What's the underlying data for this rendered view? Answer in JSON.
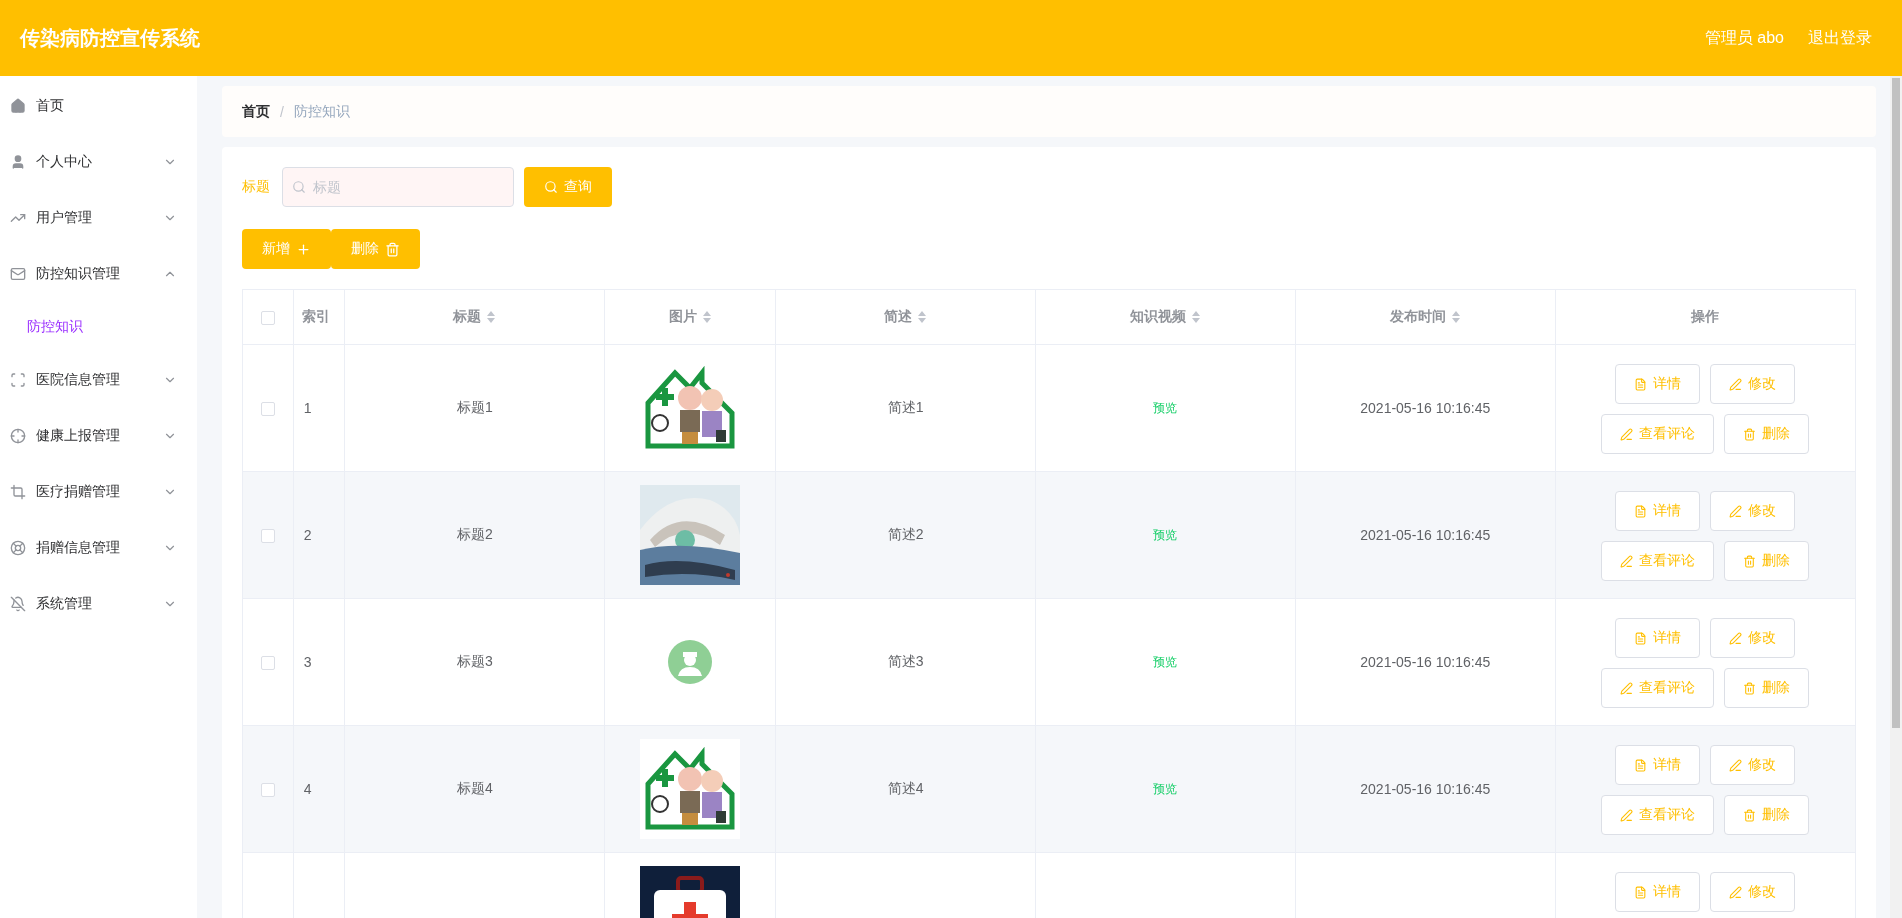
{
  "header": {
    "title": "传染病防控宣传系统",
    "user": "管理员 abo",
    "logout": "退出登录"
  },
  "sidebar": {
    "items": [
      {
        "kind": "link",
        "label": "首页"
      },
      {
        "kind": "menu",
        "label": "个人中心",
        "expanded": false
      },
      {
        "kind": "menu",
        "label": "用户管理",
        "expanded": false
      },
      {
        "kind": "menu",
        "label": "防控知识管理",
        "expanded": true,
        "children": [
          {
            "label": "防控知识",
            "selected": true
          }
        ]
      },
      {
        "kind": "menu",
        "label": "医院信息管理",
        "expanded": false
      },
      {
        "kind": "menu",
        "label": "健康上报管理",
        "expanded": false
      },
      {
        "kind": "menu",
        "label": "医疗捐赠管理",
        "expanded": false
      },
      {
        "kind": "menu",
        "label": "捐赠信息管理",
        "expanded": false
      },
      {
        "kind": "menu",
        "label": "系统管理",
        "expanded": false
      }
    ]
  },
  "breadcrumb": {
    "items": [
      "首页",
      "防控知识"
    ],
    "separator": "/"
  },
  "search": {
    "label": "标题",
    "placeholder": "标题",
    "button": "查询"
  },
  "actions": [
    {
      "label": "新增"
    },
    {
      "label": "删除"
    }
  ],
  "table": {
    "select_all": {
      "checked": false
    },
    "columns": [
      {
        "label": "索引",
        "sortable": false
      },
      {
        "label": "标题",
        "sortable": true
      },
      {
        "label": "图片",
        "sortable": true
      },
      {
        "label": "简述",
        "sortable": true
      },
      {
        "label": "知识视频",
        "sortable": true
      },
      {
        "label": "发布时间",
        "sortable": true
      },
      {
        "label": "操作",
        "sortable": false
      }
    ],
    "rows": [
      {
        "checked": false,
        "index": "1",
        "title": "标题1",
        "image": {
          "kind": "picture"
        },
        "summary": "简述1",
        "video": "预览",
        "time": "2021-05-16 10:16:45",
        "buttons": [
          {
            "label": "详情"
          },
          {
            "label": "修改"
          },
          {
            "label": "查看评论"
          },
          {
            "label": "删除"
          }
        ]
      },
      {
        "checked": false,
        "index": "2",
        "title": "标题2",
        "image": {
          "kind": "picture"
        },
        "summary": "简述2",
        "video": "预览",
        "time": "2021-05-16 10:16:45",
        "buttons": [
          {
            "label": "详情"
          },
          {
            "label": "修改"
          },
          {
            "label": "查看评论"
          },
          {
            "label": "删除"
          }
        ]
      },
      {
        "checked": false,
        "index": "3",
        "title": "标题3",
        "image": {
          "kind": "avatar"
        },
        "summary": "简述3",
        "video": "预览",
        "time": "2021-05-16 10:16:45",
        "buttons": [
          {
            "label": "详情"
          },
          {
            "label": "修改"
          },
          {
            "label": "查看评论"
          },
          {
            "label": "删除"
          }
        ]
      },
      {
        "checked": false,
        "index": "4",
        "title": "标题4",
        "image": {
          "kind": "picture"
        },
        "summary": "简述4",
        "video": "预览",
        "time": "2021-05-16 10:16:45",
        "buttons": [
          {
            "label": "详情"
          },
          {
            "label": "修改"
          },
          {
            "label": "查看评论"
          },
          {
            "label": "删除"
          }
        ]
      },
      {
        "image": {
          "kind": "picture"
        },
        "buttons": [
          {
            "label": "详情"
          },
          {
            "label": "修改"
          }
        ]
      }
    ]
  }
}
